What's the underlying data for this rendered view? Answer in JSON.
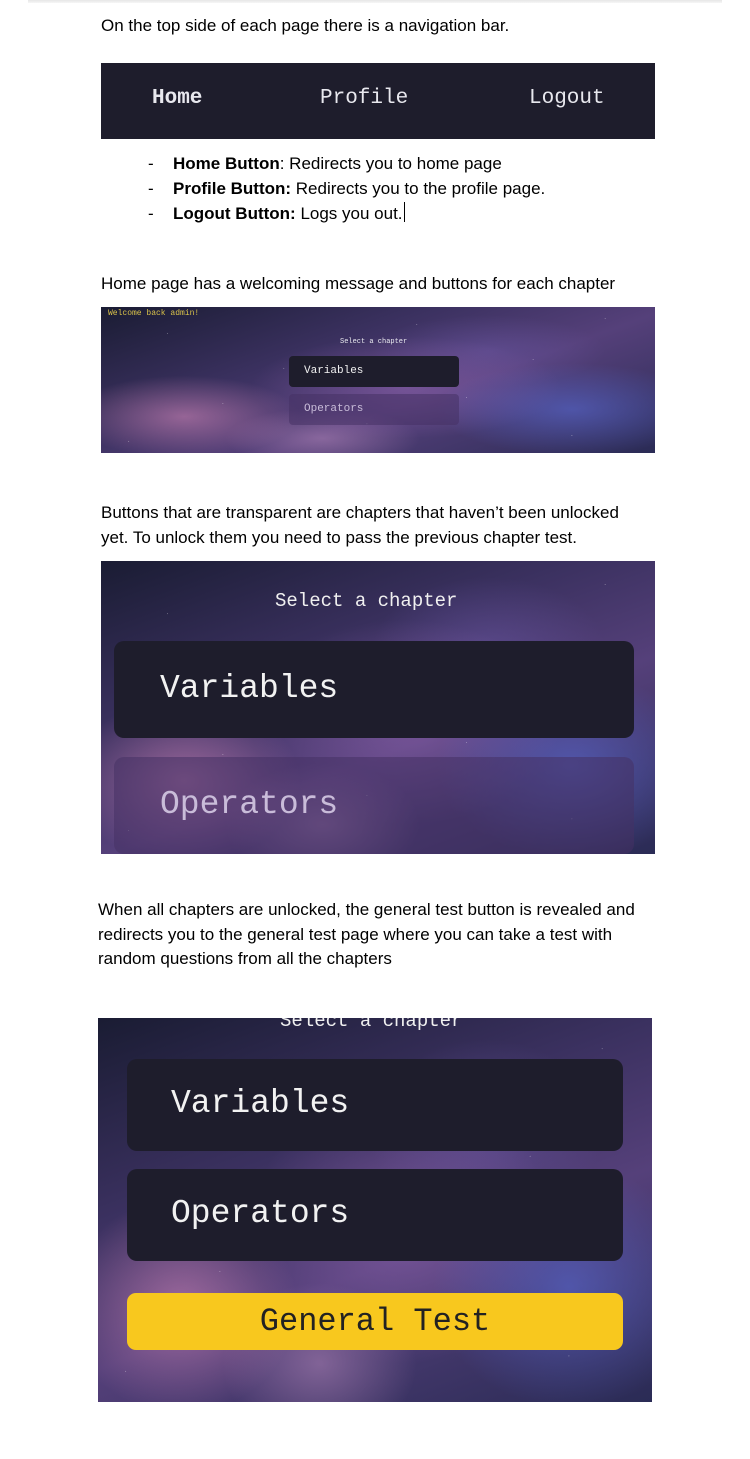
{
  "paragraphs": {
    "navbar_intro": "On the top side of each page there is a navigation bar.",
    "home_intro": "Home page has a welcoming message and buttons for each chapter",
    "locked_line1": "Buttons that are transparent are chapters that haven’t been unlocked",
    "locked_line2": "yet. To unlock them you need to pass the previous chapter test.",
    "general_line1": "When all chapters are unlocked, the general test button is revealed and",
    "general_line2": "redirects you to the general test page where you can take a test with",
    "general_line3": "random questions from all the chapters"
  },
  "navbar": {
    "home": "Home",
    "profile": "Profile",
    "logout": "Logout"
  },
  "bullets": [
    {
      "dash": "-",
      "term": "Home Button",
      "sep": ":",
      "desc": " Redirects you to home page"
    },
    {
      "dash": "-",
      "term": "Profile Button:",
      "sep": "",
      "desc": " Redirects you to the profile page."
    },
    {
      "dash": "-",
      "term": "Logout Button:",
      "sep": "",
      "desc": " Logs you out."
    }
  ],
  "home_screenshot": {
    "welcome": "Welcome back admin!",
    "select_label": "Select a chapter",
    "chapter1": "Variables",
    "chapter2": "Operators"
  },
  "locked_screenshot": {
    "select_label": "Select a chapter",
    "chapter1": "Variables",
    "chapter2": "Operators"
  },
  "unlocked_screenshot": {
    "select_label": "Select a chapter",
    "chapter1": "Variables",
    "chapter2": "Operators",
    "general_test": "General Test"
  },
  "colors": {
    "navbar_bg": "#1e1d2c",
    "button_bg": "#1e1d2c",
    "general_test_bg": "#f8c81e",
    "welcome_text": "#d9c24a"
  }
}
